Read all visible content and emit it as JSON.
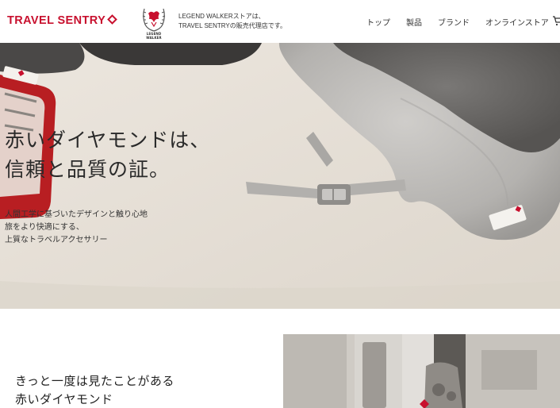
{
  "header": {
    "brand": "TRAVEL SENTRY",
    "crest_label": "LEGEND WALKER",
    "store_note": [
      "LEGEND WALKERストアは、",
      "TRAVEL SENTRYの販売代理店です。"
    ],
    "nav": [
      "トップ",
      "製品",
      "ブランド",
      "オンラインストア"
    ],
    "cart_icon": "cart-icon",
    "brand_color": "#c8102e"
  },
  "hero": {
    "headline": [
      "赤いダイヤモンドは、",
      "信頼と品質の証。"
    ],
    "body": [
      "人間工学に基づいたデザインと触り心地",
      "旅をより快適にする、",
      "上質なトラベルアクセサリー"
    ],
    "tag_text": [
      "TRAVEL",
      "SENTRY"
    ]
  },
  "section2": {
    "title": [
      "きっと一度は見たことがある",
      "赤いダイヤモンド"
    ]
  }
}
